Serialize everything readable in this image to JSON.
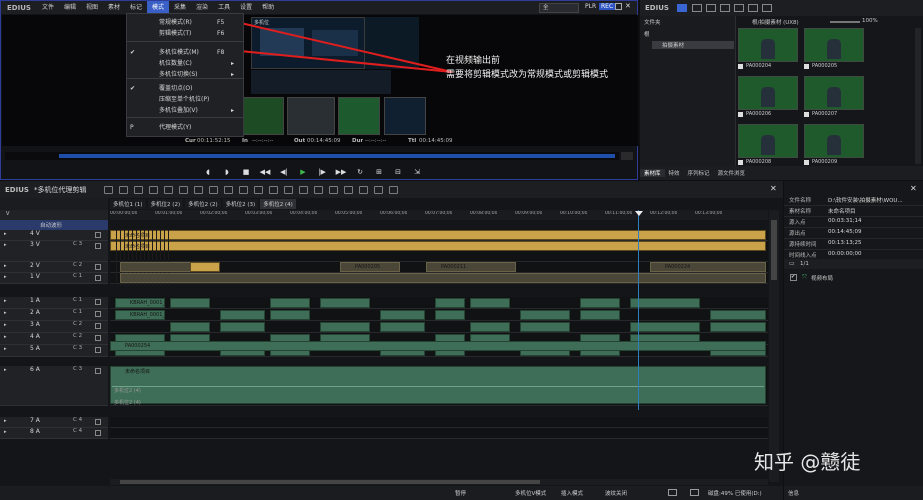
{
  "player": {
    "logo": "EDIUS",
    "menu": [
      "文件",
      "编辑",
      "视图",
      "素材",
      "标记",
      "模式",
      "采集",
      "渲染",
      "工具",
      "设置",
      "帮助"
    ],
    "selected_menu": "模式",
    "mode_field": "全",
    "plr": "PLR",
    "rec": "REC",
    "dropdown": [
      {
        "check": "",
        "label": "常规模式(R)",
        "shortcut": "F5",
        "arrow": false
      },
      {
        "check": "",
        "label": "剪辑模式(T)",
        "shortcut": "F6",
        "arrow": false
      },
      {
        "check": "✔",
        "label": "多机位模式(M)",
        "shortcut": "F8",
        "arrow": false
      },
      {
        "check": "",
        "label": "机位数量(C)",
        "shortcut": "",
        "arrow": true
      },
      {
        "check": "",
        "label": "多机位切换(S)",
        "shortcut": "",
        "arrow": true
      },
      {
        "check": "✔",
        "label": "覆盖切点(O)",
        "shortcut": "",
        "arrow": false
      },
      {
        "check": "",
        "label": "压缩至单个机位(P)",
        "shortcut": "",
        "arrow": false
      },
      {
        "check": "",
        "label": "多机位叠加(V)",
        "shortcut": "",
        "arrow": true
      },
      {
        "check": "P",
        "label": "代理模式(Y)",
        "shortcut": "",
        "arrow": false
      }
    ],
    "cam_label": "多机位",
    "annotation_1": "在视频输出前",
    "annotation_2": "需要将剪辑模式改为常规模式或剪辑模式",
    "timecodes": {
      "cur_label": "Cur",
      "cur": "00:11:52:15",
      "in_label": "In",
      "in": "--:--:--:--",
      "out_label": "Out",
      "out": "00:14:45:09",
      "dur_label": "Dur",
      "dur": "--:--:--:--",
      "ttl_label": "Ttl",
      "ttl": "00:14:45:09"
    }
  },
  "bin": {
    "logo": "EDIUS",
    "path": "根/拍摄素材 (UX8)",
    "zoom": "100%",
    "folder_header": "文件夹",
    "folders": [
      "根",
      "拍摄素材"
    ],
    "clips": [
      "PA000204",
      "PA000205",
      "PA000206",
      "PA000207",
      "PA000208",
      "PA000209"
    ],
    "tabs": [
      "素材库",
      "特效",
      "序列标记",
      "源文件浏览"
    ]
  },
  "timeline": {
    "logo": "EDIUS",
    "title": "*多机位代理剪辑",
    "tabs": [
      "多机位1 (1)",
      "多机位2 (2)",
      "多机位2 (2)",
      "多机位2 (3)",
      "多机位2 (4)"
    ],
    "active_tab": 4,
    "track_mode": "自动波形",
    "ruler": [
      "00:00:00;00",
      "00:01:00;00",
      "00:02:00;00",
      "00:03:00;00",
      "00:04:00;00",
      "00:05:00;00",
      "00:06:00;00",
      "00:07:00;00",
      "00:08:00;00",
      "00:09:00;00",
      "00:10:00;00",
      "00:11:00;00",
      "00:12:00;00",
      "00:13:00;00"
    ],
    "tracks": [
      {
        "name": "4 V",
        "ch": ""
      },
      {
        "name": "3 V",
        "ch": "C 3"
      },
      {
        "name": "2 V",
        "ch": "C 2"
      },
      {
        "name": "1 V",
        "ch": "C 1"
      },
      {
        "name": "1 A",
        "ch": "C 1"
      },
      {
        "name": "2 A",
        "ch": "C 1"
      },
      {
        "name": "3 A",
        "ch": "C 2"
      },
      {
        "name": "4 A",
        "ch": "C 2"
      },
      {
        "name": "5 A",
        "ch": "C 3"
      },
      {
        "name": "6 A",
        "ch": "C 3"
      },
      {
        "name": "7 A",
        "ch": "C 4"
      },
      {
        "name": "8 A",
        "ch": "C 4"
      }
    ],
    "clip_unnamed": "未命名项目",
    "clip_ids": [
      "PA000205",
      "PA000211",
      "PA000224",
      "PA000254"
    ],
    "clip_audio": "KBRAH_0001_360...",
    "multicam_labels": [
      "多机位2 (4)",
      "多机位2 (4)"
    ],
    "status": {
      "pause": "暂停",
      "mode": "多机位V模式",
      "insert": "插入模式",
      "ripple": "波纹关闭",
      "disk": "磁盘:49% 已使用(D:)"
    }
  },
  "info": {
    "rows": [
      {
        "k": "文件名称",
        "v": "D:\\软件安装\\拍摄素材\\WOU..."
      },
      {
        "k": "素材名称",
        "v": "未命名项目"
      },
      {
        "k": "源入点",
        "v": "00:03:31;14"
      },
      {
        "k": "源出点",
        "v": "00:14:45;09"
      },
      {
        "k": "源持续时间",
        "v": "00:13:13;25"
      },
      {
        "k": "时间线入点",
        "v": "00:00:00;00"
      }
    ],
    "page": "1/1",
    "layout_label": "视频布局",
    "bottom_tab": "信息"
  },
  "watermark": "知乎 @戆徒"
}
